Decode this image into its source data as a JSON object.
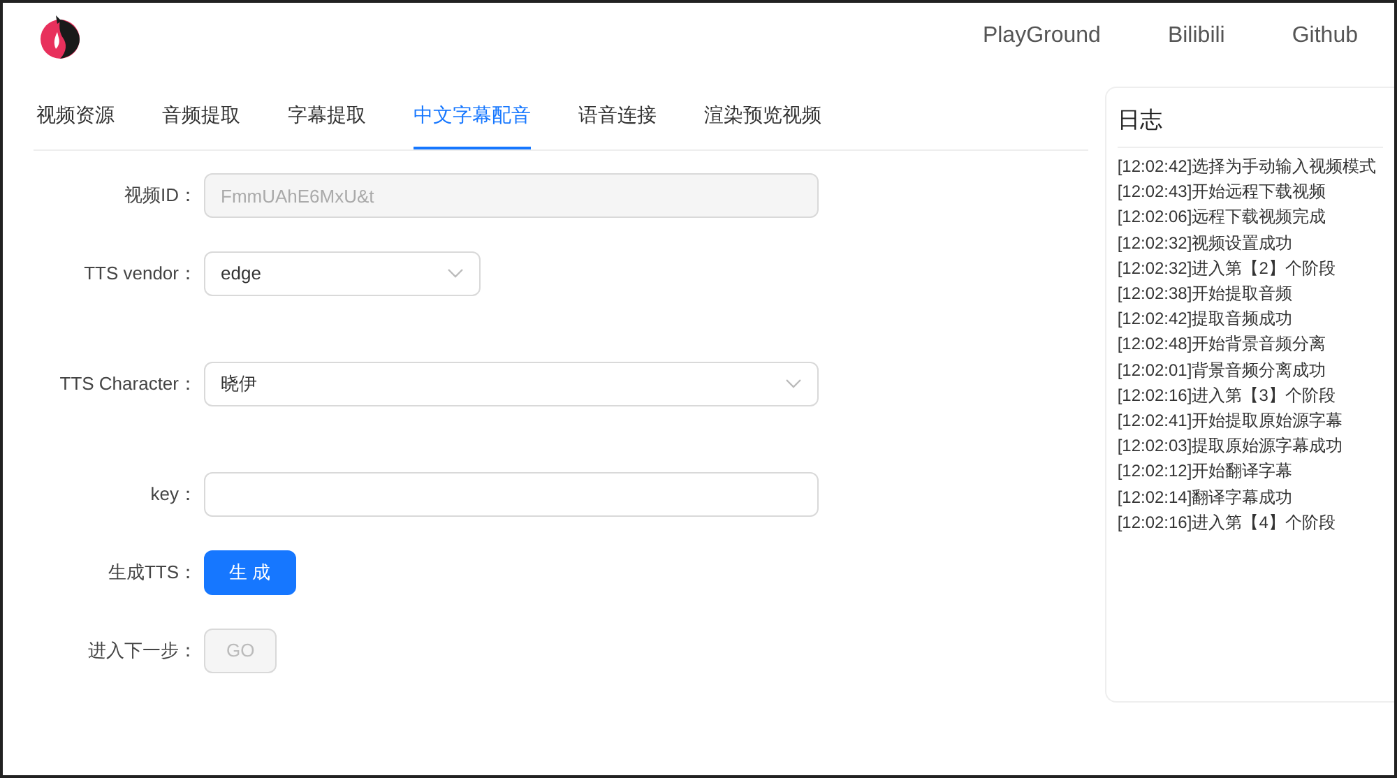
{
  "nav": {
    "links": [
      "PlayGround",
      "Bilibili",
      "Github"
    ]
  },
  "tabs": [
    {
      "label": "视频资源",
      "selected": false
    },
    {
      "label": "音频提取",
      "selected": false
    },
    {
      "label": "字幕提取",
      "selected": false
    },
    {
      "label": "中文字幕配音",
      "selected": true
    },
    {
      "label": "语音连接",
      "selected": false
    },
    {
      "label": "渲染预览视频",
      "selected": false
    }
  ],
  "form": [
    {
      "kind": "input",
      "label": "视频ID：",
      "value": "FmmUAhE6MxU&t",
      "disabled": true
    },
    {
      "kind": "select",
      "label": "TTS vendor：",
      "value": "edge",
      "wide": false
    },
    {
      "kind": "select",
      "label": "TTS Character：",
      "value": "晓伊",
      "wide": true
    },
    {
      "kind": "input",
      "label": "key："
    },
    {
      "kind": "button",
      "label": "生成TTS：",
      "text": "生 成",
      "disabled": false
    },
    {
      "kind": "button",
      "label": "进入下一步：",
      "text": "GO",
      "disabled": true
    }
  ],
  "log": {
    "title": "日志",
    "entries": [
      "[12:02:42]选择为手动输入视频模式",
      "[12:02:43]开始远程下载视频",
      "[12:02:06]远程下载视频完成",
      "[12:02:32]视频设置成功",
      "[12:02:32]进入第【2】个阶段",
      "[12:02:38]开始提取音频",
      "[12:02:42]提取音频成功",
      "[12:02:48]开始背景音频分离",
      "[12:02:01]背景音频分离成功",
      "[12:02:16]进入第【3】个阶段",
      "[12:02:41]开始提取原始源字幕",
      "[12:02:03]提取原始源字幕成功",
      "[12:02:12]开始翻译字幕",
      "[12:02:14]翻译字幕成功",
      "[12:02:16]进入第【4】个阶段"
    ]
  }
}
